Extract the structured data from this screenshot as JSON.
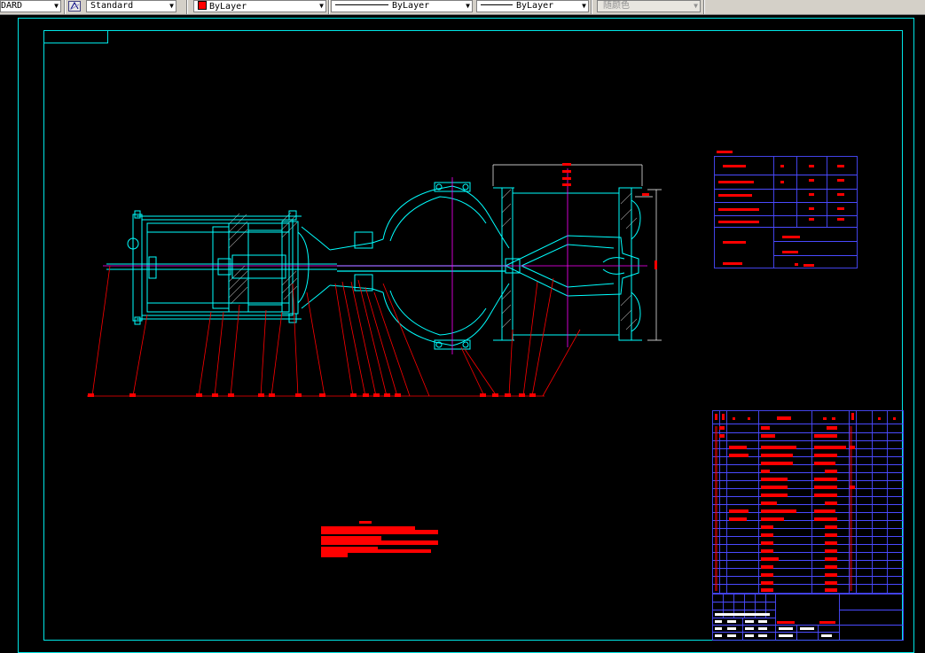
{
  "toolbar": {
    "dimstyle": "DARD",
    "textstyle": "Standard",
    "color": "ByLayer",
    "linetype": "ByLayer",
    "lineweight": "ByLayer",
    "plotstyle": "随颜色"
  },
  "colors": {
    "background": "#000000",
    "border": "#00e5e5",
    "geometry": "#00ffff",
    "accent": "#ff00ff",
    "leaders": "#ff0000",
    "labels": "#ff0000",
    "table_lines": "#4a4aff",
    "hatch": "#9a9a9a"
  },
  "icons": {
    "textstyle_icon": "text-style-icon",
    "dropdown": "chevron-down-icon"
  },
  "drawing": {
    "view": "pneumatic knife gate valve assembly section view"
  }
}
